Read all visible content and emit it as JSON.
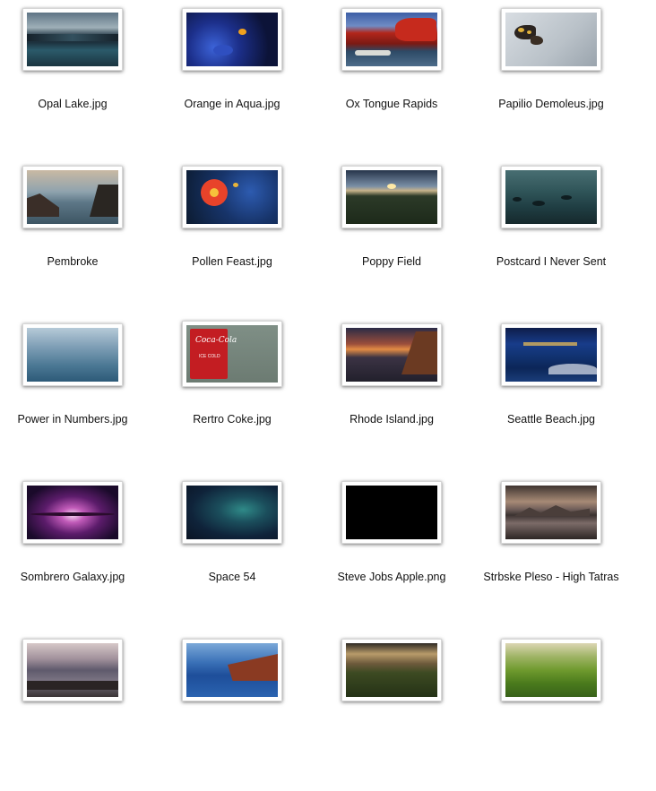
{
  "items": [
    {
      "label": "Opal Lake.jpg",
      "thumb": "opal-lake"
    },
    {
      "label": "Orange in Aqua.jpg",
      "thumb": "orange-in-aqua"
    },
    {
      "label": "Ox Tongue Rapids",
      "thumb": "ox-tongue-rapids"
    },
    {
      "label": "Papilio Demoleus.jpg",
      "thumb": "papilio-demoleus"
    },
    {
      "label": "Pembroke",
      "thumb": "pembroke"
    },
    {
      "label": "Pollen Feast.jpg",
      "thumb": "pollen-feast"
    },
    {
      "label": "Poppy Field",
      "thumb": "poppy-field"
    },
    {
      "label": "Postcard I Never Sent",
      "thumb": "postcard"
    },
    {
      "label": "Power in Numbers.jpg",
      "thumb": "power-in-numbers"
    },
    {
      "label": "Rertro Coke.jpg",
      "thumb": "retro-coke",
      "sign": "Coca-Cola",
      "sign_sub": "ICE COLD"
    },
    {
      "label": "Rhode Island.jpg",
      "thumb": "rhode-island"
    },
    {
      "label": "Seattle Beach.jpg",
      "thumb": "seattle-beach"
    },
    {
      "label": "Sombrero Galaxy.jpg",
      "thumb": "sombrero-galaxy"
    },
    {
      "label": "Space 54",
      "thumb": "space-54"
    },
    {
      "label": "Steve Jobs Apple.png",
      "thumb": "steve-jobs-apple",
      "logo": ""
    },
    {
      "label": "Strbske Pleso - High Tatras",
      "thumb": "strbske-pleso"
    },
    {
      "label": "",
      "thumb": "misty-lake"
    },
    {
      "label": "",
      "thumb": "shipwreck"
    },
    {
      "label": "",
      "thumb": "cloudy-hills"
    },
    {
      "label": "",
      "thumb": "tea-plantation"
    }
  ]
}
